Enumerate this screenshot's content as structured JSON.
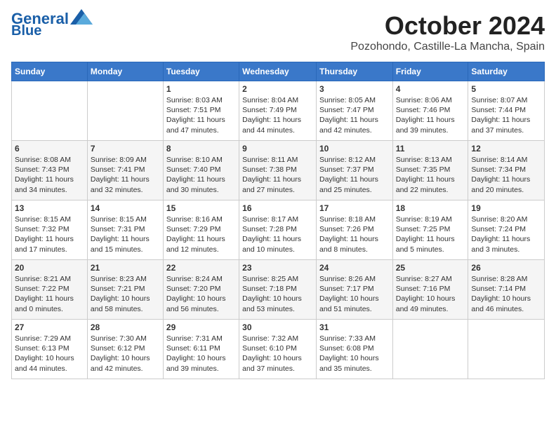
{
  "header": {
    "logo_line1": "General",
    "logo_line2": "Blue",
    "title": "October 2024",
    "subtitle": "Pozohondo, Castille-La Mancha, Spain"
  },
  "days_of_week": [
    "Sunday",
    "Monday",
    "Tuesday",
    "Wednesday",
    "Thursday",
    "Friday",
    "Saturday"
  ],
  "weeks": [
    [
      {
        "day": "",
        "content": ""
      },
      {
        "day": "",
        "content": ""
      },
      {
        "day": "1",
        "content": "Sunrise: 8:03 AM\nSunset: 7:51 PM\nDaylight: 11 hours and 47 minutes."
      },
      {
        "day": "2",
        "content": "Sunrise: 8:04 AM\nSunset: 7:49 PM\nDaylight: 11 hours and 44 minutes."
      },
      {
        "day": "3",
        "content": "Sunrise: 8:05 AM\nSunset: 7:47 PM\nDaylight: 11 hours and 42 minutes."
      },
      {
        "day": "4",
        "content": "Sunrise: 8:06 AM\nSunset: 7:46 PM\nDaylight: 11 hours and 39 minutes."
      },
      {
        "day": "5",
        "content": "Sunrise: 8:07 AM\nSunset: 7:44 PM\nDaylight: 11 hours and 37 minutes."
      }
    ],
    [
      {
        "day": "6",
        "content": "Sunrise: 8:08 AM\nSunset: 7:43 PM\nDaylight: 11 hours and 34 minutes."
      },
      {
        "day": "7",
        "content": "Sunrise: 8:09 AM\nSunset: 7:41 PM\nDaylight: 11 hours and 32 minutes."
      },
      {
        "day": "8",
        "content": "Sunrise: 8:10 AM\nSunset: 7:40 PM\nDaylight: 11 hours and 30 minutes."
      },
      {
        "day": "9",
        "content": "Sunrise: 8:11 AM\nSunset: 7:38 PM\nDaylight: 11 hours and 27 minutes."
      },
      {
        "day": "10",
        "content": "Sunrise: 8:12 AM\nSunset: 7:37 PM\nDaylight: 11 hours and 25 minutes."
      },
      {
        "day": "11",
        "content": "Sunrise: 8:13 AM\nSunset: 7:35 PM\nDaylight: 11 hours and 22 minutes."
      },
      {
        "day": "12",
        "content": "Sunrise: 8:14 AM\nSunset: 7:34 PM\nDaylight: 11 hours and 20 minutes."
      }
    ],
    [
      {
        "day": "13",
        "content": "Sunrise: 8:15 AM\nSunset: 7:32 PM\nDaylight: 11 hours and 17 minutes."
      },
      {
        "day": "14",
        "content": "Sunrise: 8:15 AM\nSunset: 7:31 PM\nDaylight: 11 hours and 15 minutes."
      },
      {
        "day": "15",
        "content": "Sunrise: 8:16 AM\nSunset: 7:29 PM\nDaylight: 11 hours and 12 minutes."
      },
      {
        "day": "16",
        "content": "Sunrise: 8:17 AM\nSunset: 7:28 PM\nDaylight: 11 hours and 10 minutes."
      },
      {
        "day": "17",
        "content": "Sunrise: 8:18 AM\nSunset: 7:26 PM\nDaylight: 11 hours and 8 minutes."
      },
      {
        "day": "18",
        "content": "Sunrise: 8:19 AM\nSunset: 7:25 PM\nDaylight: 11 hours and 5 minutes."
      },
      {
        "day": "19",
        "content": "Sunrise: 8:20 AM\nSunset: 7:24 PM\nDaylight: 11 hours and 3 minutes."
      }
    ],
    [
      {
        "day": "20",
        "content": "Sunrise: 8:21 AM\nSunset: 7:22 PM\nDaylight: 11 hours and 0 minutes."
      },
      {
        "day": "21",
        "content": "Sunrise: 8:23 AM\nSunset: 7:21 PM\nDaylight: 10 hours and 58 minutes."
      },
      {
        "day": "22",
        "content": "Sunrise: 8:24 AM\nSunset: 7:20 PM\nDaylight: 10 hours and 56 minutes."
      },
      {
        "day": "23",
        "content": "Sunrise: 8:25 AM\nSunset: 7:18 PM\nDaylight: 10 hours and 53 minutes."
      },
      {
        "day": "24",
        "content": "Sunrise: 8:26 AM\nSunset: 7:17 PM\nDaylight: 10 hours and 51 minutes."
      },
      {
        "day": "25",
        "content": "Sunrise: 8:27 AM\nSunset: 7:16 PM\nDaylight: 10 hours and 49 minutes."
      },
      {
        "day": "26",
        "content": "Sunrise: 8:28 AM\nSunset: 7:14 PM\nDaylight: 10 hours and 46 minutes."
      }
    ],
    [
      {
        "day": "27",
        "content": "Sunrise: 7:29 AM\nSunset: 6:13 PM\nDaylight: 10 hours and 44 minutes."
      },
      {
        "day": "28",
        "content": "Sunrise: 7:30 AM\nSunset: 6:12 PM\nDaylight: 10 hours and 42 minutes."
      },
      {
        "day": "29",
        "content": "Sunrise: 7:31 AM\nSunset: 6:11 PM\nDaylight: 10 hours and 39 minutes."
      },
      {
        "day": "30",
        "content": "Sunrise: 7:32 AM\nSunset: 6:10 PM\nDaylight: 10 hours and 37 minutes."
      },
      {
        "day": "31",
        "content": "Sunrise: 7:33 AM\nSunset: 6:08 PM\nDaylight: 10 hours and 35 minutes."
      },
      {
        "day": "",
        "content": ""
      },
      {
        "day": "",
        "content": ""
      }
    ]
  ]
}
